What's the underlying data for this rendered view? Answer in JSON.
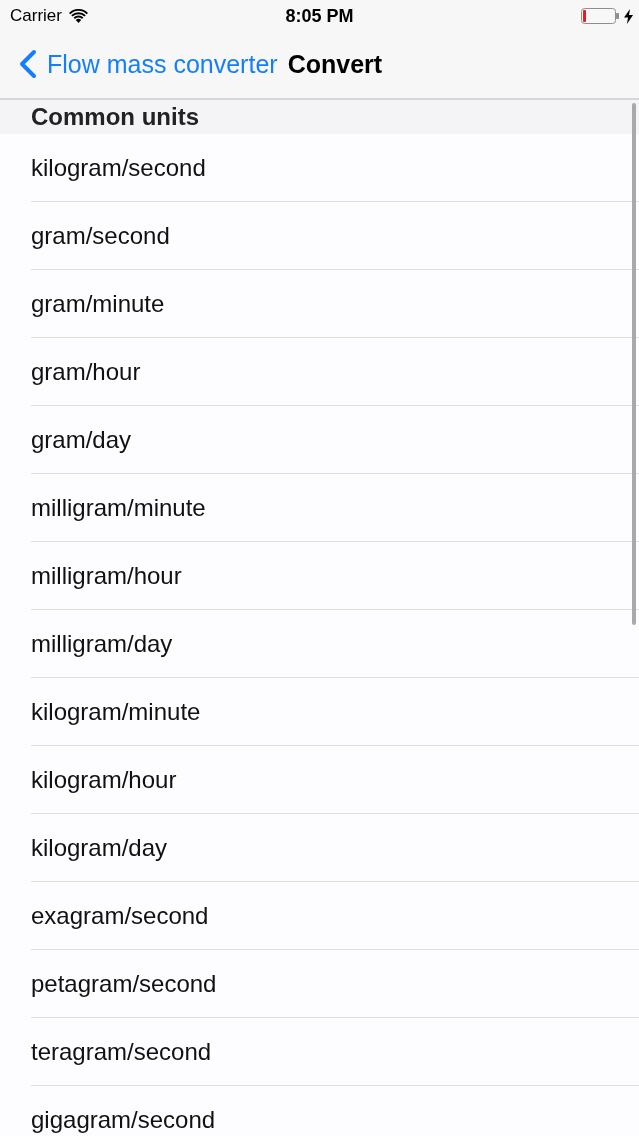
{
  "status_bar": {
    "carrier": "Carrier",
    "time": "8:05 PM"
  },
  "nav_bar": {
    "back_label": "Flow mass converter",
    "title": "Convert"
  },
  "sections": [
    {
      "header": "Common units",
      "rows": [
        "kilogram/second",
        "gram/second",
        "gram/minute",
        "gram/hour",
        "gram/day",
        "milligram/minute",
        "milligram/hour",
        "milligram/day",
        "kilogram/minute",
        "kilogram/hour",
        "kilogram/day",
        "exagram/second",
        "petagram/second",
        "teragram/second",
        "gigagram/second"
      ]
    }
  ]
}
